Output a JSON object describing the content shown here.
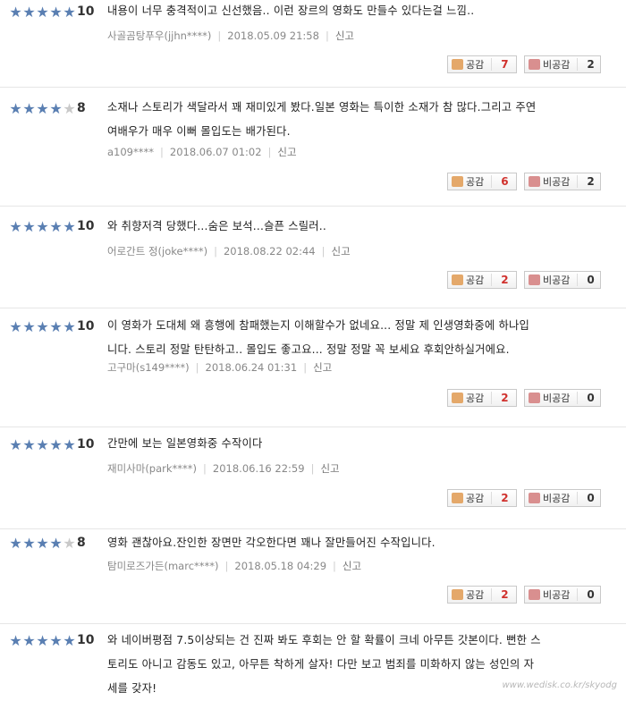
{
  "reviews": [
    {
      "stars": 5,
      "score": "10",
      "lines": [
        "내용이 너무 충격적이고 신선했음.. 이런 장르의 영화도 만들수 있다는걸 느낌.."
      ],
      "user": "사골곰탕푸우(jjhn****)",
      "date": "2018.05.09 21:58",
      "report": "신고",
      "like_label": "공감",
      "like": "7",
      "dislike_label": "비공감",
      "dislike": "2"
    },
    {
      "stars": 4,
      "score": "8",
      "lines": [
        "소재나 스토리가 색달라서 꽤 재미있게 봤다.일본 영화는 특이한 소재가 참 많다.그리고 주연",
        "여배우가 매우 이뻐 몰입도는 배가된다."
      ],
      "user": "a109****",
      "date": "2018.06.07 01:02",
      "report": "신고",
      "like_label": "공감",
      "like": "6",
      "dislike_label": "비공감",
      "dislike": "2"
    },
    {
      "stars": 5,
      "score": "10",
      "lines": [
        "와 취향저격 당했다...숨은 보석...슬픈 스릴러.."
      ],
      "user": "어로간트 정(joke****)",
      "date": "2018.08.22 02:44",
      "report": "신고",
      "like_label": "공감",
      "like": "2",
      "dislike_label": "비공감",
      "dislike": "0"
    },
    {
      "stars": 5,
      "score": "10",
      "lines": [
        "이 영화가 도대체 왜 흥행에 참패했는지 이해할수가 없네요... 정말 제 인생영화중에 하나입",
        "니다. 스토리 정말 탄탄하고.. 몰입도 좋고요... 정말 정말 꼭 보세요 후회안하실거에요."
      ],
      "user": "고구마(s149****)",
      "date": "2018.06.24 01:31",
      "report": "신고",
      "like_label": "공감",
      "like": "2",
      "dislike_label": "비공감",
      "dislike": "0"
    },
    {
      "stars": 5,
      "score": "10",
      "lines": [
        "간만에 보는 일본영화중 수작이다"
      ],
      "user": "재미사마(park****)",
      "date": "2018.06.16 22:59",
      "report": "신고",
      "like_label": "공감",
      "like": "2",
      "dislike_label": "비공감",
      "dislike": "0"
    },
    {
      "stars": 4,
      "score": "8",
      "lines": [
        "영화 괜찮아요.잔인한 장면만 각오한다면 꽤나 잘만들어진 수작입니다."
      ],
      "user": "탐미로즈가든(marc****)",
      "date": "2018.05.18 04:29",
      "report": "신고",
      "like_label": "공감",
      "like": "2",
      "dislike_label": "비공감",
      "dislike": "0"
    },
    {
      "stars": 5,
      "score": "10",
      "lines": [
        "와 네이버평점 7.5이상되는 건 진짜 봐도 후회는 안 할 확률이 크네 아무튼 갓본이다. 뻔한 스",
        "토리도 아니고 감동도 있고, 아무튼 착하게 살자! 다만 보고 범죄를 미화하지 않는 성인의 자",
        "세를 갖자!"
      ],
      "user": "",
      "date": "",
      "report": "",
      "like_label": "",
      "like": "",
      "dislike_label": "",
      "dislike": ""
    }
  ],
  "watermark": "www.wedisk.co.kr/skyodg",
  "colors": {
    "star_on": "#5a7fb2",
    "star_off": "#c9c9c9",
    "like_count": "#d0312d"
  },
  "icons": {
    "like": "thumbs-up-icon",
    "dislike": "thumbs-down-icon",
    "star": "star-icon"
  }
}
